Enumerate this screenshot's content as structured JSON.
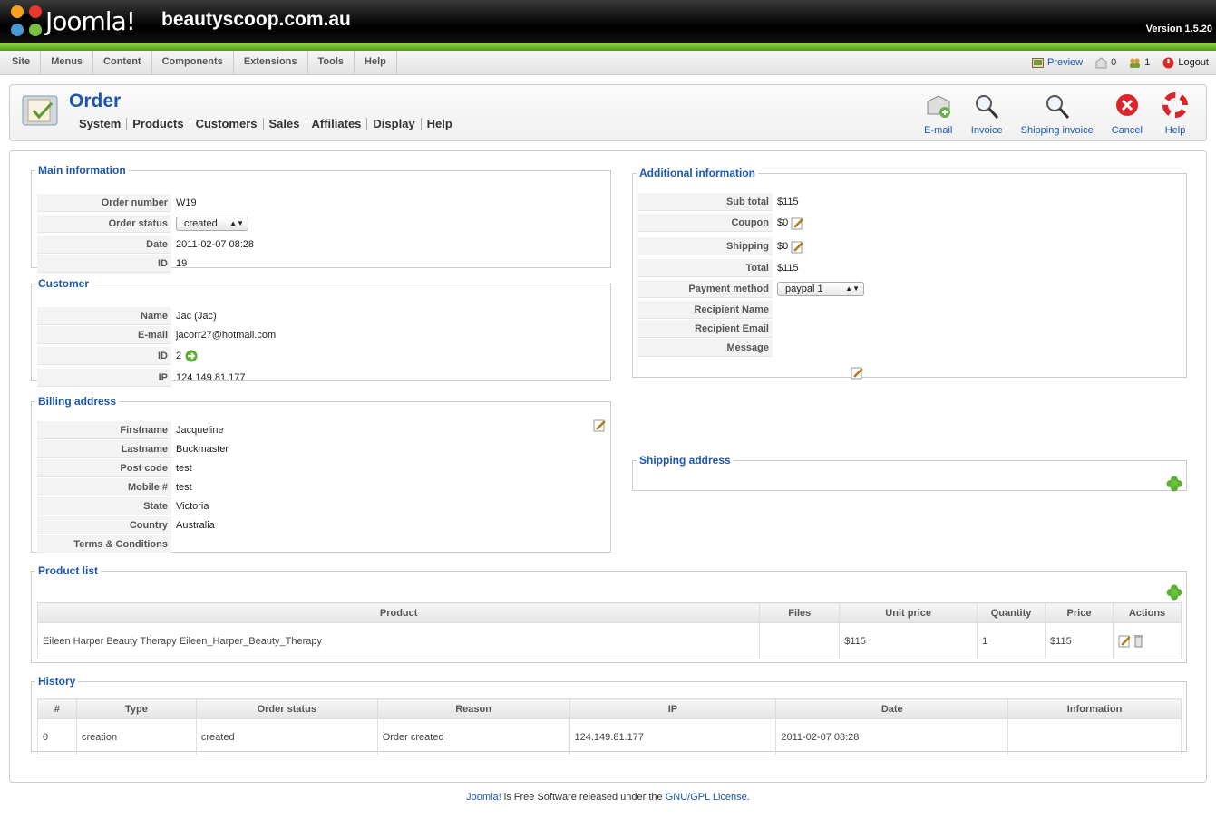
{
  "header": {
    "logo_text": "Joomla!",
    "site_name": "beautyscoop.com.au",
    "version": "Version 1.5.20"
  },
  "menu": [
    "Site",
    "Menus",
    "Content",
    "Components",
    "Extensions",
    "Tools",
    "Help"
  ],
  "status": {
    "preview": "Preview",
    "messages_count": "0",
    "users_count": "1",
    "logout": "Logout"
  },
  "page": {
    "title": "Order",
    "submenu": [
      "System",
      "Products",
      "Customers",
      "Sales",
      "Affiliates",
      "Display",
      "Help"
    ]
  },
  "toolbar": {
    "email": "E-mail",
    "invoice": "Invoice",
    "shipping_invoice": "Shipping invoice",
    "cancel": "Cancel",
    "help": "Help"
  },
  "main_info": {
    "legend": "Main information",
    "order_number_label": "Order number",
    "order_number": "W19",
    "order_status_label": "Order status",
    "order_status": "created",
    "date_label": "Date",
    "date": "2011-02-07 08:28",
    "id_label": "ID",
    "id": "19"
  },
  "customer": {
    "legend": "Customer",
    "name_label": "Name",
    "name": "Jac (Jac)",
    "email_label": "E-mail",
    "email": "jacorr27@hotmail.com",
    "id_label": "ID",
    "id": "2",
    "ip_label": "IP",
    "ip": "124.149.81.177"
  },
  "billing": {
    "legend": "Billing address",
    "firstname_label": "Firstname",
    "firstname": "Jacqueline",
    "lastname_label": "Lastname",
    "lastname": "Buckmaster",
    "postcode_label": "Post code",
    "postcode": "test",
    "mobile_label": "Mobile #",
    "mobile": "test",
    "state_label": "State",
    "state": "Victoria",
    "country_label": "Country",
    "country": "Australia",
    "terms_label": "Terms & Conditions",
    "terms": ""
  },
  "additional": {
    "legend": "Additional information",
    "subtotal_label": "Sub total",
    "subtotal": "$115",
    "coupon_label": "Coupon",
    "coupon": "$0",
    "shipping_label": "Shipping",
    "shipping": "$0",
    "total_label": "Total",
    "total": "$115",
    "payment_label": "Payment method",
    "payment": "paypal 1",
    "recipient_name_label": "Recipient Name",
    "recipient_email_label": "Recipient Email",
    "message_label": "Message"
  },
  "shipping_address": {
    "legend": "Shipping address"
  },
  "products": {
    "legend": "Product list",
    "columns": [
      "Product",
      "Files",
      "Unit price",
      "Quantity",
      "Price",
      "Actions"
    ],
    "rows": [
      {
        "product": "Eileen Harper Beauty Therapy Eileen_Harper_Beauty_Therapy",
        "files": "",
        "unit_price": "$115",
        "quantity": "1",
        "price": "$115"
      }
    ]
  },
  "history": {
    "legend": "History",
    "columns": [
      "#",
      "Type",
      "Order status",
      "Reason",
      "IP",
      "Date",
      "Information"
    ],
    "rows": [
      {
        "num": "0",
        "type": "creation",
        "status": "created",
        "reason": "Order created",
        "ip": "124.149.81.177",
        "date": "2011-02-07 08:28",
        "info": ""
      }
    ]
  },
  "footer": {
    "joomla": "Joomla!",
    "text": " is Free Software released under the ",
    "license": "GNU/GPL License",
    "end": "."
  },
  "colors": {
    "accent_blue": "#1b57b1",
    "header_green": "#6fba2c"
  }
}
